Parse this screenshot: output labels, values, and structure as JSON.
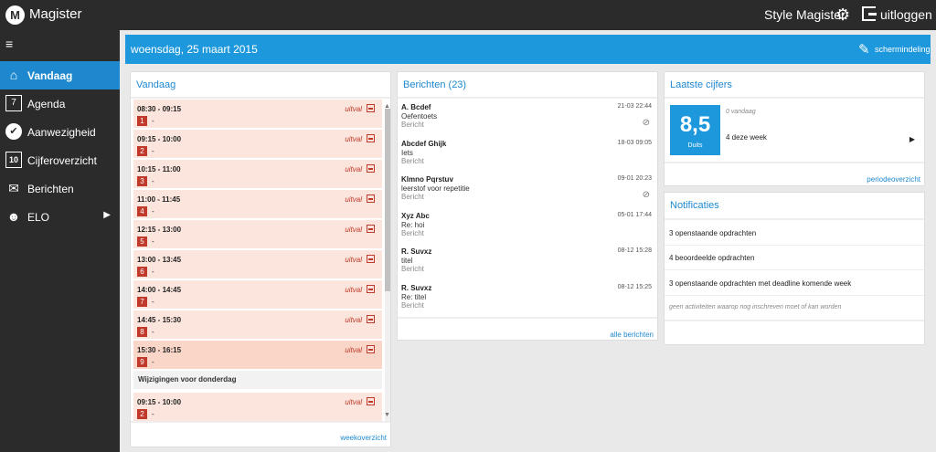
{
  "app": {
    "name": "Magister",
    "logo": "M",
    "style_label": "Style Magister",
    "logout_label": "uitloggen",
    "gear_icon": "⚙"
  },
  "sidebar": {
    "collapse_icon": "≡",
    "items": [
      {
        "label": "Vandaag",
        "icon": "⌂",
        "active": true
      },
      {
        "label": "Agenda",
        "icon": "7"
      },
      {
        "label": "Aanwezigheid",
        "icon": "✔"
      },
      {
        "label": "Cijferoverzicht",
        "icon": "10"
      },
      {
        "label": "Berichten",
        "icon": "✉"
      },
      {
        "label": "ELO",
        "icon": "☻",
        "arrow": "▶"
      }
    ]
  },
  "header": {
    "date": "woensdag, 25 maart 2015",
    "layout_label": "schermindeling",
    "pencil_icon": "✎"
  },
  "today": {
    "title": "Vandaag",
    "uitval": "uitval",
    "dash": "-",
    "change_header": "Wijzigingen voor donderdag",
    "week_link": "weekoverzicht",
    "lessons": [
      {
        "time": "08:30 - 09:15",
        "hour": "1"
      },
      {
        "time": "09:15 - 10:00",
        "hour": "2"
      },
      {
        "time": "10:15 - 11:00",
        "hour": "3"
      },
      {
        "time": "11:00 - 11:45",
        "hour": "4"
      },
      {
        "time": "12:15 - 13:00",
        "hour": "5"
      },
      {
        "time": "13:00 - 13:45",
        "hour": "6"
      },
      {
        "time": "14:00 - 14:45",
        "hour": "7"
      },
      {
        "time": "14:45 - 15:30",
        "hour": "8"
      },
      {
        "time": "15:30 - 16:15",
        "hour": "9"
      },
      {
        "time": "09:15 - 10:00",
        "hour": "2"
      }
    ]
  },
  "messages": {
    "title": "Berichten (23)",
    "type_label": "Bericht",
    "clip_icon": "⊘",
    "all_link": "alle berichten",
    "items": [
      {
        "sender": "A. Bcdef",
        "subject": "Oefentoets",
        "date": "21-03 22:44",
        "attachment": true
      },
      {
        "sender": "Abcdef Ghijk",
        "subject": "Iets",
        "date": "18-03 09:05"
      },
      {
        "sender": "Klmno Pqrstuv",
        "subject": "leerstof voor repetitie",
        "date": "09-01 20:23",
        "attachment": true
      },
      {
        "sender": "Xyz Abc",
        "subject": "Re: hoi",
        "date": "05-01 17:44"
      },
      {
        "sender": "R. Suvxz",
        "subject": "titel",
        "date": "08-12 15:28"
      },
      {
        "sender": "R. Suvxz",
        "subject": "Re: titel",
        "date": "08-12 15:25"
      }
    ]
  },
  "grades": {
    "title": "Laatste cijfers",
    "value": "8,5",
    "subject": "Duits",
    "today": "0 vandaag",
    "week": "4 deze week",
    "arrow": "▶",
    "period_link": "periodeoverzicht"
  },
  "notifications": {
    "title": "Notificaties",
    "items": [
      "3 openstaande opdrachten",
      "4 beoordeelde opdrachten",
      "3 openstaande opdrachten met deadline komende week"
    ],
    "info": "geen activiteiten waarop nog inschreven moet of kan worden"
  }
}
